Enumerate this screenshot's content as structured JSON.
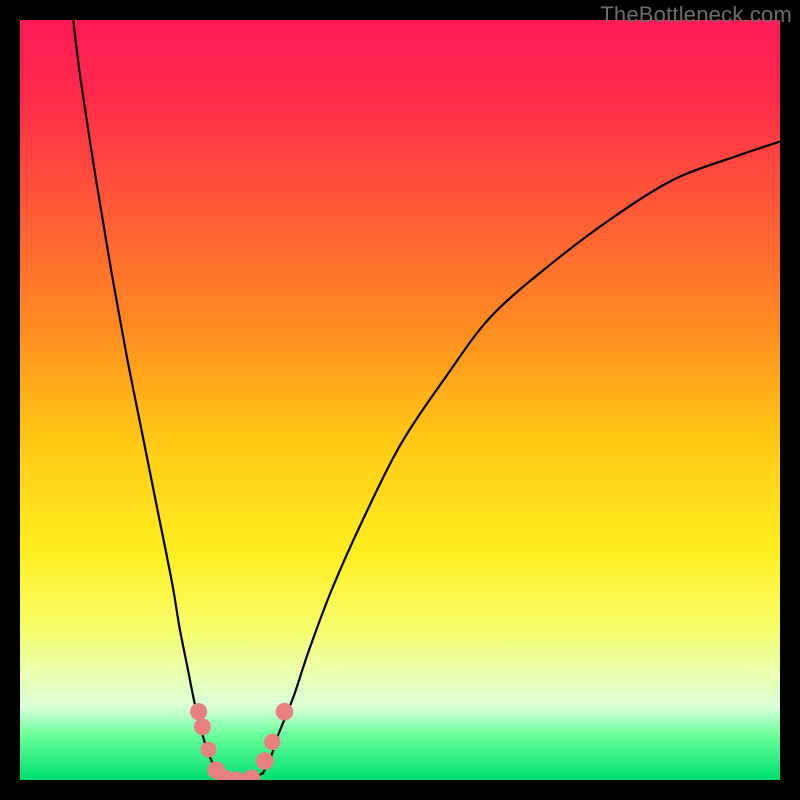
{
  "watermark": "TheBottleneck.com",
  "colors": {
    "gradient_stops": [
      {
        "offset": 0.0,
        "color": "#ff1a55"
      },
      {
        "offset": 0.1,
        "color": "#ff2b4a"
      },
      {
        "offset": 0.25,
        "color": "#ff5a36"
      },
      {
        "offset": 0.4,
        "color": "#ff8a22"
      },
      {
        "offset": 0.55,
        "color": "#ffc814"
      },
      {
        "offset": 0.7,
        "color": "#ffee20"
      },
      {
        "offset": 0.8,
        "color": "#f6ff6a"
      },
      {
        "offset": 0.86,
        "color": "#eaffb0"
      },
      {
        "offset": 0.905,
        "color": "#d8ffd8"
      },
      {
        "offset": 0.94,
        "color": "#6bff9b"
      },
      {
        "offset": 1.0,
        "color": "#00e070"
      }
    ],
    "curve": "#000000",
    "marker": "#e98080"
  },
  "chart_data": {
    "type": "line",
    "title": "",
    "xlabel": "",
    "ylabel": "",
    "xlim": [
      0,
      100
    ],
    "ylim": [
      0,
      100
    ],
    "grid": false,
    "legend": false,
    "series": [
      {
        "name": "left-branch",
        "x": [
          7,
          8,
          10,
          12,
          14,
          16,
          18,
          20,
          21,
          22,
          23,
          24,
          25,
          26
        ],
        "y": [
          100,
          92,
          79,
          67,
          56,
          46,
          36,
          26,
          20,
          15,
          10,
          6,
          3,
          1
        ]
      },
      {
        "name": "right-branch",
        "x": [
          32,
          33,
          34,
          36,
          38,
          41,
          45,
          50,
          56,
          62,
          70,
          78,
          86,
          94,
          100
        ],
        "y": [
          1,
          3,
          6,
          11,
          17,
          25,
          34,
          44,
          53,
          61,
          68,
          74,
          79,
          82,
          84
        ]
      },
      {
        "name": "valley-floor",
        "x": [
          26,
          27,
          28,
          29,
          30,
          31,
          32
        ],
        "y": [
          1,
          0.3,
          0,
          0,
          0,
          0.3,
          1
        ]
      }
    ],
    "markers": [
      {
        "x": 23.5,
        "y": 9.0,
        "r": 1.5
      },
      {
        "x": 24.0,
        "y": 7.0,
        "r": 1.5
      },
      {
        "x": 24.8,
        "y": 4.0,
        "r": 1.3
      },
      {
        "x": 25.8,
        "y": 1.3,
        "r": 1.6
      },
      {
        "x": 27.0,
        "y": 0.2,
        "r": 1.6
      },
      {
        "x": 28.5,
        "y": 0.0,
        "r": 1.6
      },
      {
        "x": 30.5,
        "y": 0.2,
        "r": 1.6
      },
      {
        "x": 32.2,
        "y": 2.5,
        "r": 1.6
      },
      {
        "x": 33.2,
        "y": 5.0,
        "r": 1.4
      },
      {
        "x": 34.8,
        "y": 9.0,
        "r": 1.6
      }
    ]
  }
}
